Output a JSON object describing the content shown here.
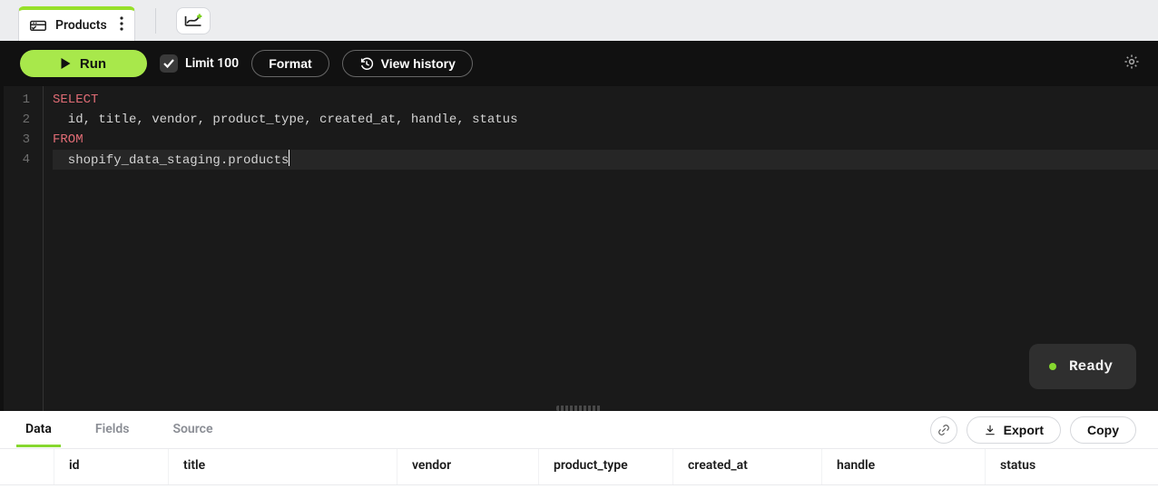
{
  "tab": {
    "title": "Products"
  },
  "toolbar": {
    "run_label": "Run",
    "limit_label": "Limit 100",
    "format_label": "Format",
    "history_label": "View history"
  },
  "editor": {
    "lines": [
      {
        "n": "1",
        "tokens": [
          {
            "t": "SELECT",
            "c": "kw"
          }
        ]
      },
      {
        "n": "2",
        "tokens": [
          {
            "t": "  id, title, vendor, product_type, created_at, handle, status"
          }
        ]
      },
      {
        "n": "3",
        "tokens": [
          {
            "t": "FROM",
            "c": "kw"
          }
        ]
      },
      {
        "n": "4",
        "tokens": [
          {
            "t": "  shopify_data_staging.products"
          }
        ],
        "active": true,
        "cursor": true
      }
    ]
  },
  "status": {
    "label": "Ready"
  },
  "results": {
    "tabs": {
      "data": "Data",
      "fields": "Fields",
      "source": "Source"
    },
    "export_label": "Export",
    "copy_label": "Copy",
    "columns": {
      "id": "id",
      "title": "title",
      "vendor": "vendor",
      "product_type": "product_type",
      "created_at": "created_at",
      "handle": "handle",
      "status": "status"
    }
  }
}
